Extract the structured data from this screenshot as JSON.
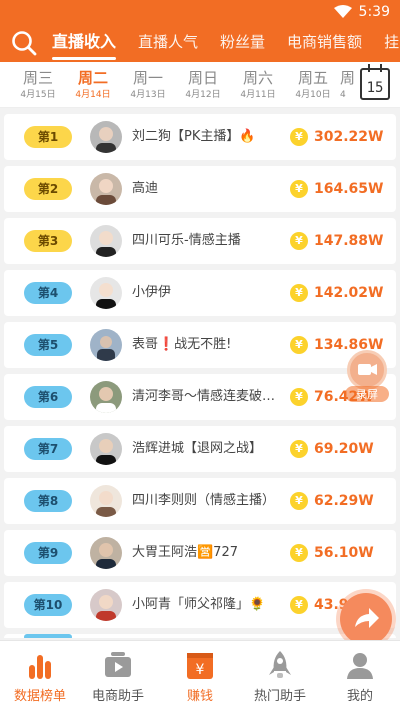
{
  "status_bar": {
    "time": "5:39"
  },
  "top_tabs": [
    {
      "label": "直播收入",
      "active": true
    },
    {
      "label": "直播人气",
      "active": false
    },
    {
      "label": "粉丝量",
      "active": false
    },
    {
      "label": "电商销售额",
      "active": false
    },
    {
      "label": "挂",
      "active": false
    }
  ],
  "days": [
    {
      "name": "周三",
      "date": "4月15日",
      "active": false
    },
    {
      "name": "周二",
      "date": "4月14日",
      "active": true
    },
    {
      "name": "周一",
      "date": "4月13日",
      "active": false
    },
    {
      "name": "周日",
      "date": "4月12日",
      "active": false
    },
    {
      "name": "周六",
      "date": "4月11日",
      "active": false
    },
    {
      "name": "周五",
      "date": "4月10日",
      "active": false
    },
    {
      "name": "周",
      "date": "4",
      "active": false
    }
  ],
  "calendar": {
    "day": "15"
  },
  "ranking": [
    {
      "rank": "第1",
      "name": "刘二狗【PK主播】🔥",
      "amount": "302.22W"
    },
    {
      "rank": "第2",
      "name": "高迪",
      "amount": "164.65W"
    },
    {
      "rank": "第3",
      "name": "四川可乐-情感主播",
      "amount": "147.88W"
    },
    {
      "rank": "第4",
      "name": "小伊伊",
      "amount": "142.02W"
    },
    {
      "rank": "第5",
      "name": "表哥❗战无不胜!",
      "amount": "134.86W"
    },
    {
      "rank": "第6",
      "name": "清河李哥～情感连麦破…",
      "amount": "76.42W"
    },
    {
      "rank": "第7",
      "name": "浩辉进城【退网之战】",
      "amount": "69.20W"
    },
    {
      "rank": "第8",
      "name": "四川李则则（情感主播）",
      "amount": "62.29W"
    },
    {
      "rank": "第9",
      "name": "大胃王阿浩🈺727",
      "amount": "56.10W"
    },
    {
      "rank": "第10",
      "name": "小阿青「师父祁隆」🌻",
      "amount": "43.93W"
    }
  ],
  "coin_symbol": "¥",
  "record_label": "录屏",
  "bottom_nav": [
    {
      "label": "数据榜单",
      "icon": "bar-chart-icon",
      "active": true
    },
    {
      "label": "电商助手",
      "icon": "video-icon",
      "active": false
    },
    {
      "label": "赚钱",
      "icon": "money-icon",
      "active": false
    },
    {
      "label": "热门助手",
      "icon": "rocket-icon",
      "active": false
    },
    {
      "label": "我的",
      "icon": "user-icon",
      "active": false
    }
  ],
  "colors": {
    "accent": "#f26d24",
    "gold": "#fcd64a",
    "blue": "#6cc6ee"
  }
}
